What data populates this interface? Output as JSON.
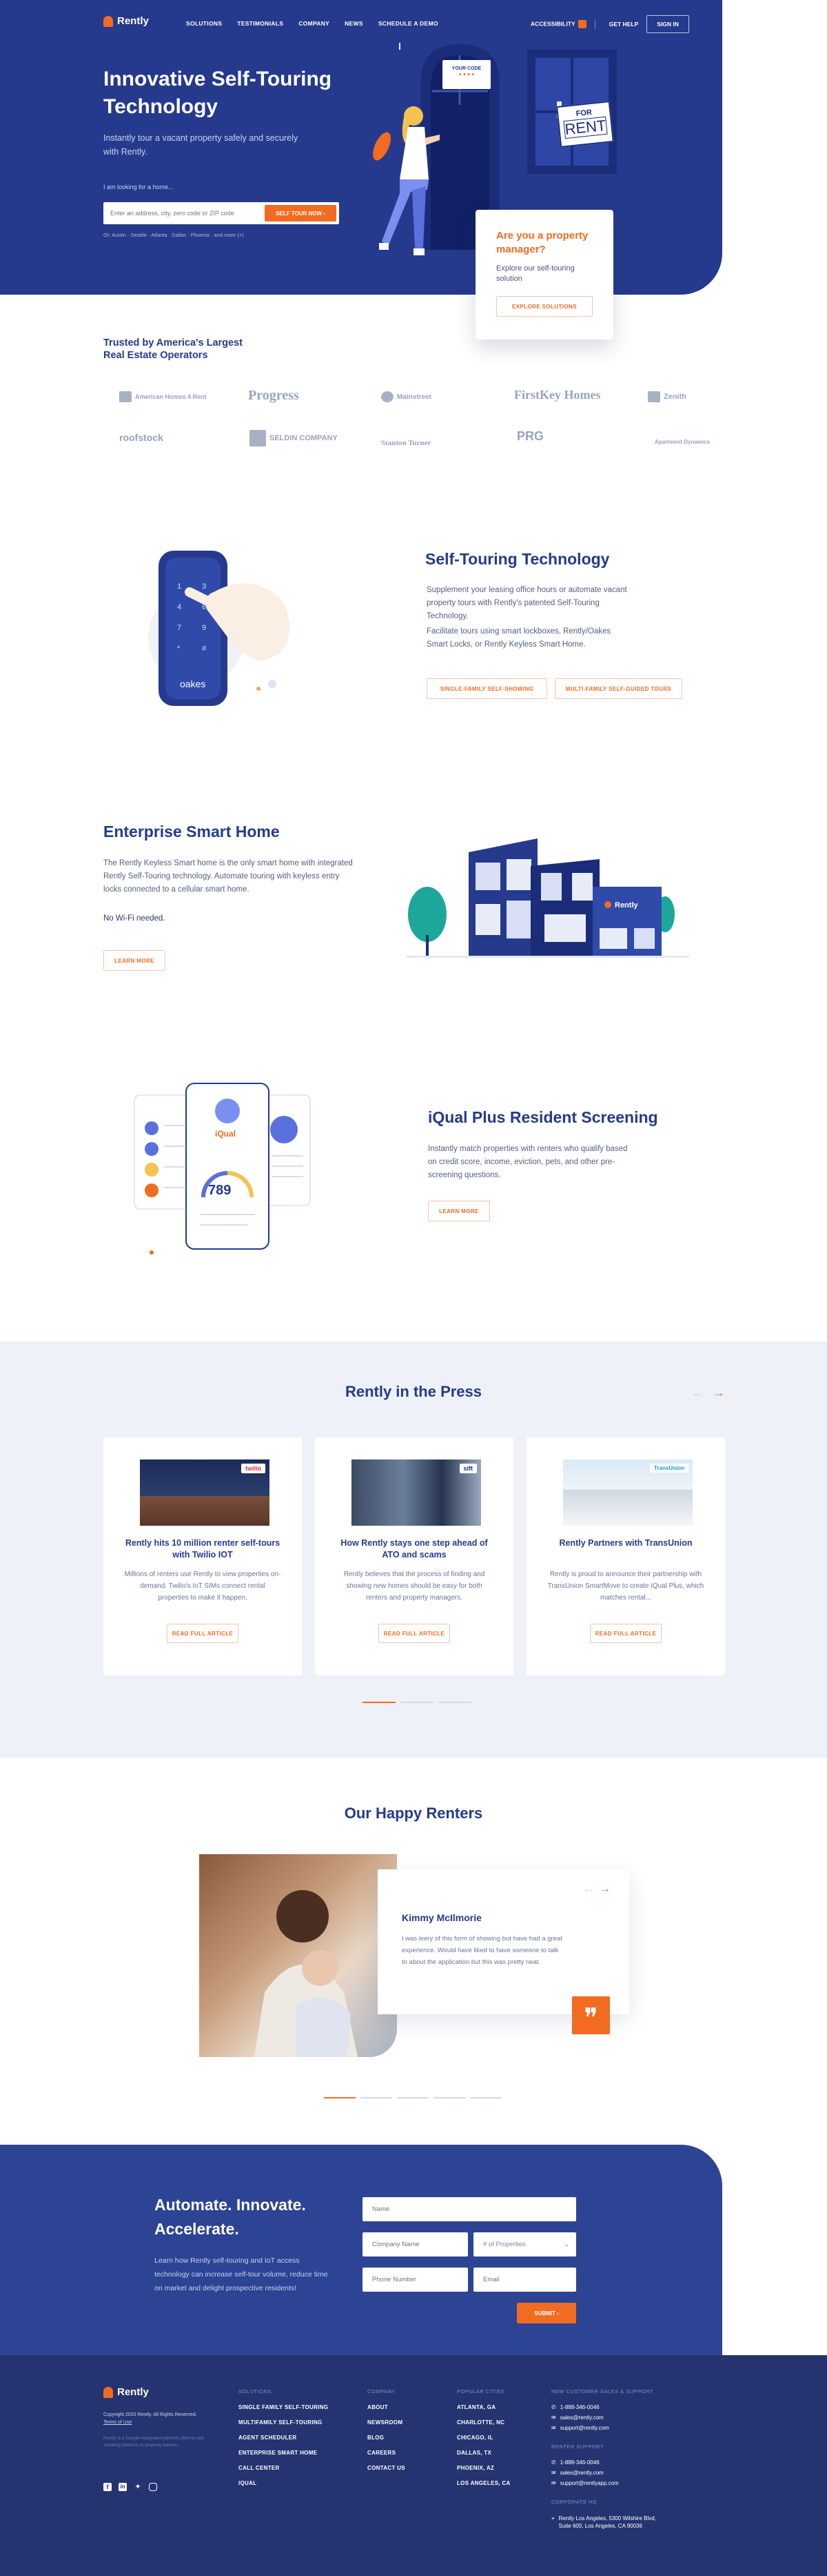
{
  "nav": {
    "brand": "Rently",
    "items": [
      "SOLUTIONS",
      "TESTIMONIALS",
      "COMPANY",
      "NEWS",
      "SCHEDULE A DEMO"
    ],
    "accessibility": "ACCESSIBILITY",
    "get_help": "GET HELP",
    "sign_in": "SIGN IN"
  },
  "hero": {
    "title": "Innovative Self-Touring Technology",
    "subtitle": "Instantly tour a vacant property safely and securely with Rently.",
    "search_label": "I am looking for a home...",
    "search_placeholder": "Enter an address, city, zero code or ZIP code",
    "search_button": "SELF TOUR NOW ›",
    "popular": "Or: Austin · Seattle · Atlanta · Dallas · Phoenix · and more (+)",
    "door_sign": "YOUR CODE",
    "door_code": "• • • •",
    "rent_sign_top": "FOR",
    "rent_sign_bottom": "RENT",
    "card_title": "Are you a property manager?",
    "card_text": "Explore our self-touring solution",
    "card_button": "EXPLORE SOLUTIONS"
  },
  "trusted": {
    "title": "Trusted by America's Largest Real Estate Operators",
    "logos": [
      "American Homes 4 Rent",
      "Progress",
      "Mainstreet",
      "FirstKey Homes",
      "Zenith",
      "roofstock",
      "SELDIN COMPANY",
      "Stanton Turner",
      "PRG",
      "Apartment Dynamics"
    ]
  },
  "self_touring": {
    "title": "Self-Touring Technology",
    "para1": "Supplement your leasing office hours or automate vacant property tours with Rently's patented Self-Touring Technology.",
    "para2": "Facilitate tours using smart lockboxes, Rently/Oakes Smart Locks, or Rently Keyless Smart Home.",
    "btn1": "SINGLE-FAMILY SELF-SHOWING",
    "btn2": "MULTI-FAMILY SELF-GUIDED TOURS",
    "lock_brand": "oakes"
  },
  "smart_home": {
    "title": "Enterprise Smart Home",
    "para1": "The Rently Keyless Smart home is the only smart home with integrated Rently Self-Touring technology. Automate touring with keyless entry locks connected to a cellular smart home.",
    "para2": "No Wi-Fi needed.",
    "button": "LEARN MORE",
    "house_brand": "Rently"
  },
  "iqual": {
    "title": "iQual Plus Resident Screening",
    "para": "Instantly match properties with renters who qualify based on credit score, income, eviction, pets, and other pre-screening questions.",
    "button": "LEARN MORE",
    "phone_brand": "iQual",
    "score": "789"
  },
  "press": {
    "title": "Rently in the Press",
    "cards": [
      {
        "title": "Rently hits 10 million renter self-tours with Twilio IOT",
        "text": "Millions of renters use Rently to view properties on-demand. Twilio's IoT SIMs connect rental properties to make it happen.",
        "button": "READ FULL ARTICLE",
        "tag": "twilio"
      },
      {
        "title": "How Rently stays one step ahead of ATO and scams",
        "text": "Rently believes that the process of finding and showing new homes should be easy for both renters and property managers.",
        "button": "READ FULL ARTICLE",
        "tag": "sift"
      },
      {
        "title": "Rently Partners with TransUnion",
        "text": "Rently is proud to announce their partnership with TransUnion SmartMove to create iQual Plus, which matches rental...",
        "button": "READ FULL ARTICLE",
        "tag": "TransUnion"
      }
    ]
  },
  "renters": {
    "title": "Our Happy Renters",
    "name": "Kimmy McIlmorie",
    "quote": "I was leery of this form of showing but have had a great experience. Would have liked to have someone to talk to about the application but this was pretty neat."
  },
  "cta": {
    "title": "Automate. Innovate. Accelerate.",
    "text": "Learn how Rently self-touring and IoT access technology can increase self-tour volume, reduce time on market and delight prospective residents!",
    "name": "Name",
    "company": "Company Name",
    "properties": "# of Properties",
    "phone": "Phone Number",
    "email": "Email",
    "submit": "SUBMIT ›"
  },
  "footer": {
    "brand": "Rently",
    "copyright": "Copyright 2020 Rently. All Rights Reserved.",
    "terms": "Terms of Use",
    "fine": "Rently is a Google-integrated platform offering self-showing solutions to property owners.",
    "solutions_h": "SOLUTIONS",
    "solutions": [
      "SINGLE FAMILY SELF-TOURING",
      "MULTIFAMILY SELF-TOURING",
      "AGENT SCHEDULER",
      "ENTERPRISE SMART HOME",
      "CALL CENTER",
      "IQUAL"
    ],
    "company_h": "COMPANY",
    "company": [
      "ABOUT",
      "NEWSROOM",
      "BLOG",
      "CAREERS",
      "CONTACT US"
    ],
    "markets_h": "POPULAR CITIES",
    "markets": [
      "ATLANTA, GA",
      "CHARLOTTE, NC",
      "CHICAGO, IL",
      "DALLAS, TX",
      "PHOENIX, AZ",
      "LOS ANGELES, CA"
    ],
    "sales_h": "NEW CUSTOMER SALES & SUPPORT",
    "sales": [
      "1-888-346-0046",
      "sales@rently.com",
      "support@rently.com"
    ],
    "renter_h": "RENTER SUPPORT",
    "renter": [
      "1-888-346-0046",
      "sales@rently.com",
      "support@rentlyapp.com"
    ],
    "hq_h": "CORPORATE HQ",
    "hq": "Rently Los Angeles, 5300 Wilshire Blvd, Suite 600, Los Angeles, CA 90036"
  },
  "colors": {
    "navy": "#253a8c",
    "orange": "#f26b21",
    "light": "#eef1f7"
  }
}
